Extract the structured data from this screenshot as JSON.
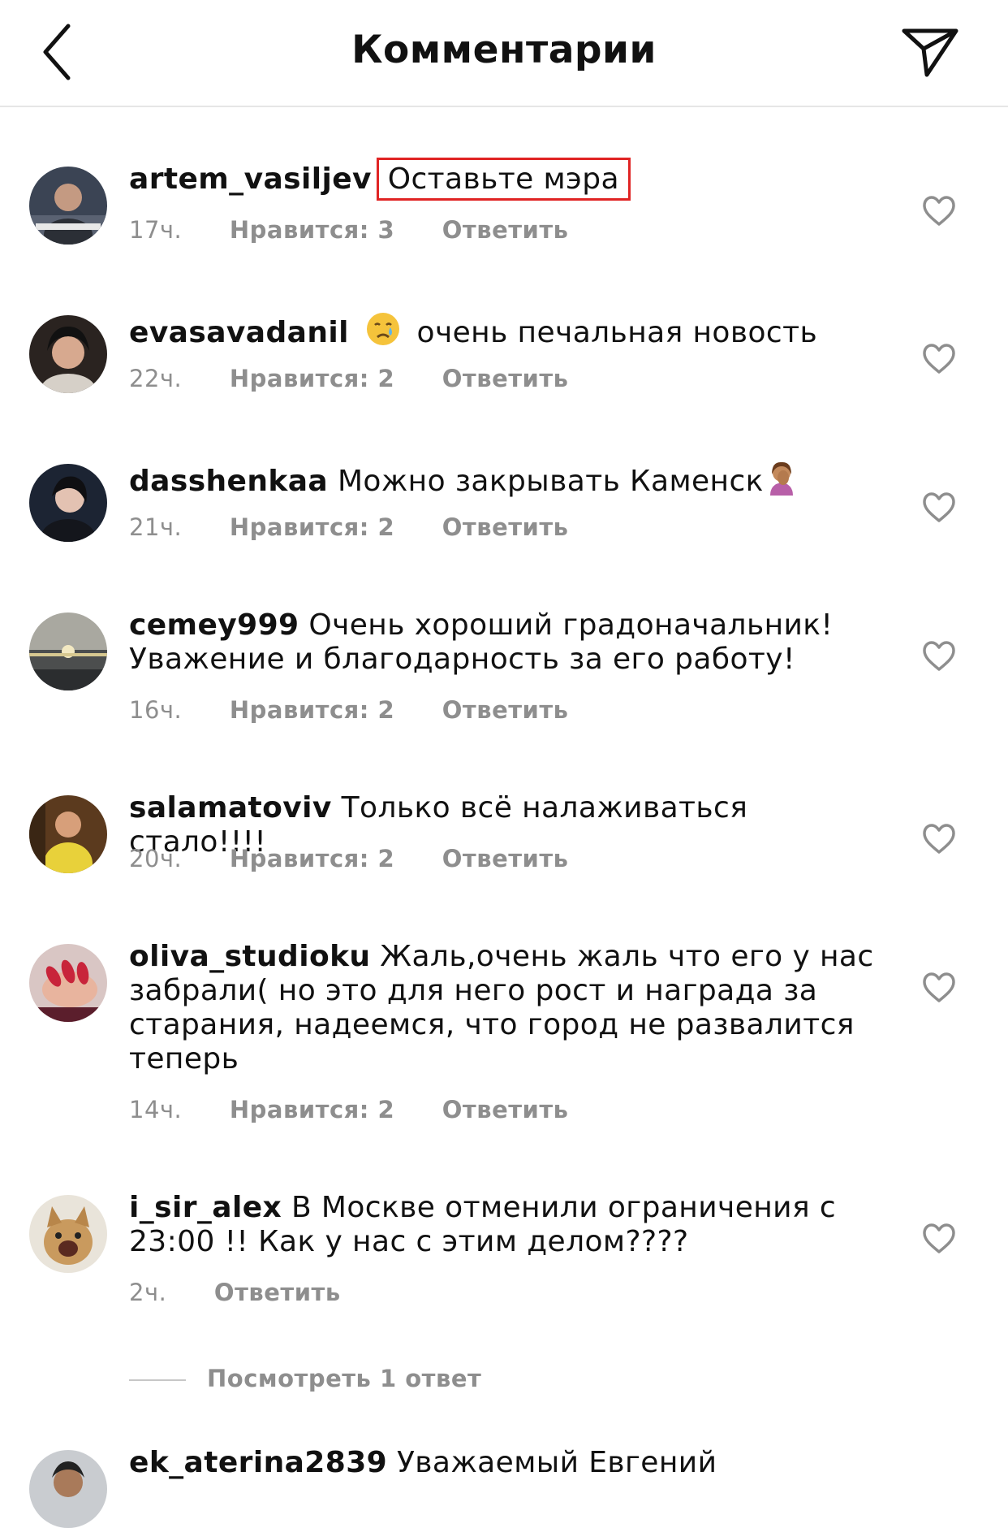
{
  "header": {
    "title": "Комментарии"
  },
  "comments": [
    {
      "user": "artem_vasiljev",
      "text": "Оставьте мэра",
      "time": "17ч.",
      "likes": "Нравится: 3",
      "reply": "Ответить"
    },
    {
      "user": "evasavadanil",
      "text": "очень печальная новость",
      "time": "22ч.",
      "likes": "Нравится: 2",
      "reply": "Ответить"
    },
    {
      "user": "dasshenkaa",
      "text": "Можно закрывать Каменск",
      "time": "21ч.",
      "likes": "Нравится: 2",
      "reply": "Ответить"
    },
    {
      "user": "cemey999",
      "text": "Очень хороший градоначальник! Уважение и благодарность за его работу!",
      "time": "16ч.",
      "likes": "Нравится: 2",
      "reply": "Ответить"
    },
    {
      "user": "salamatoviv",
      "text": "Только всё налаживаться стало!!!!",
      "time": "20ч.",
      "likes": "Нравится: 2",
      "reply": "Ответить"
    },
    {
      "user": "oliva_studioku",
      "text": "Жаль,очень жаль что его у нас забрали( но это для него рост и награда за старания, надеемся, что город не развалится теперь",
      "time": "14ч.",
      "likes": "Нравится: 2",
      "reply": "Ответить"
    },
    {
      "user": "i_sir_alex",
      "text": "В Москве отменили ограничения с 23:00 !! Как у нас с этим делом????",
      "time": "2ч.",
      "reply": "Ответить"
    },
    {
      "user": "ek_aterina2839",
      "text": "Уважаемый Евгений"
    }
  ],
  "view_replies": "Посмотреть 1 ответ"
}
